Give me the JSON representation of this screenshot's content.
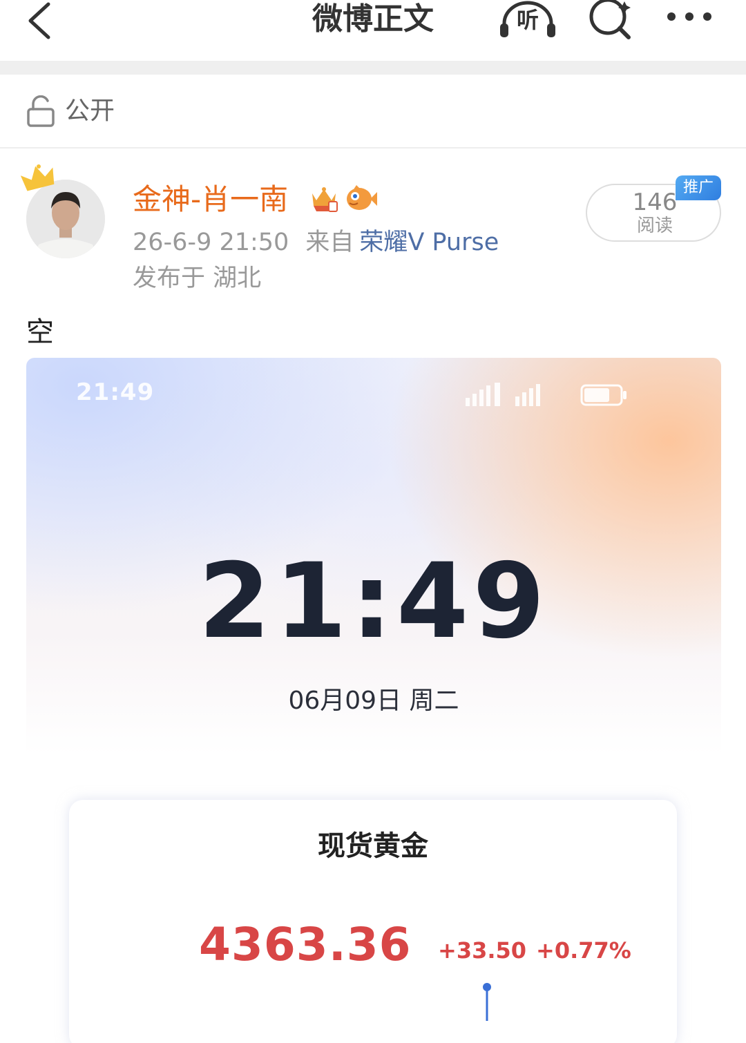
{
  "nav": {
    "title": "微博正文",
    "listen_label": "听",
    "icons": [
      "back-chevron-icon",
      "headphones-icon",
      "search-icon",
      "more-dots-icon"
    ]
  },
  "visibility": {
    "icon": "unlock-icon",
    "label": "公开"
  },
  "author": {
    "name": "金神-肖一南",
    "badges": [
      "crown-icon",
      "vip-crown-badge-icon",
      "fish-badge-icon"
    ],
    "timestamp": "26-6-9 21:50",
    "from_label": "来自",
    "source": "荣耀V Purse",
    "location": "发布于 湖北"
  },
  "reads": {
    "count": "146",
    "label": "阅读",
    "promo_badge": "推广"
  },
  "post": {
    "text": "空",
    "image": {
      "status_time": "21:49",
      "clock": "21:49",
      "date": "06月09日 周二",
      "gold": {
        "title": "现货黄金",
        "price": "4363.36",
        "change": "+33.50",
        "change_pct": "+0.77%"
      }
    }
  },
  "colors": {
    "author_name": "#e86a1b",
    "source_link": "#4e6ea6",
    "price_up": "#d84646",
    "promo_badge": "#3d8ee8"
  }
}
